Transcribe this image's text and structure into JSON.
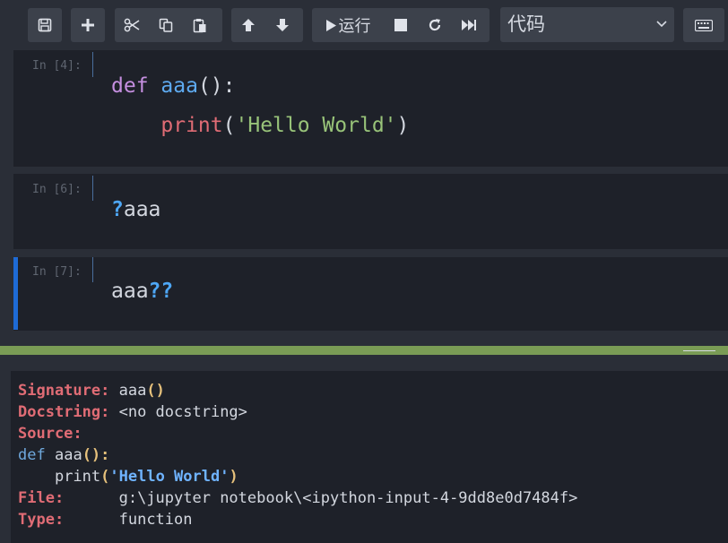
{
  "toolbar": {
    "icons": [
      "save-icon",
      "plus-icon",
      "scissors-icon",
      "copy-icon",
      "paste-icon",
      "arrow-up-icon",
      "arrow-down-icon",
      "play-icon",
      "stop-icon",
      "restart-icon",
      "fast-forward-icon",
      "keyboard-icon"
    ],
    "run_label": "运行",
    "cell_type": "代码"
  },
  "cells": [
    {
      "prompt": "In [4]:",
      "lines": [
        {
          "kw": "def",
          "fn": "aaa",
          "rest": "():"
        },
        {
          "builtin": "print",
          "open": "(",
          "str": "'Hello World'",
          "close": ")"
        }
      ]
    },
    {
      "prompt": "In [6]:",
      "code_prefix": "?",
      "code": "aaa"
    },
    {
      "prompt": "In [7]:",
      "code": "aaa",
      "code_suffix": "??"
    }
  ],
  "pager": {
    "signature_label": "Signature:",
    "signature_value": "aaa",
    "signature_parens": "()",
    "docstring_label": "Docstring:",
    "docstring_value": "<no docstring>",
    "source_label": "Source:",
    "source_line1_kw": "def",
    "source_line1_rest": "aaa",
    "source_line1_parens": "():",
    "source_line2_pre": "print",
    "source_line2_open": "(",
    "source_line2_str": "'Hello World'",
    "source_line2_close": ")",
    "file_label": "File:",
    "file_value": "g:\\jupyter notebook\\<ipython-input-4-9dd8e0d7484f>",
    "type_label": "Type:",
    "type_value": "function"
  },
  "colors": {
    "accent": "#1e6bd6",
    "pager_bar": "#7a9c55",
    "label_red": "#e06c75"
  }
}
